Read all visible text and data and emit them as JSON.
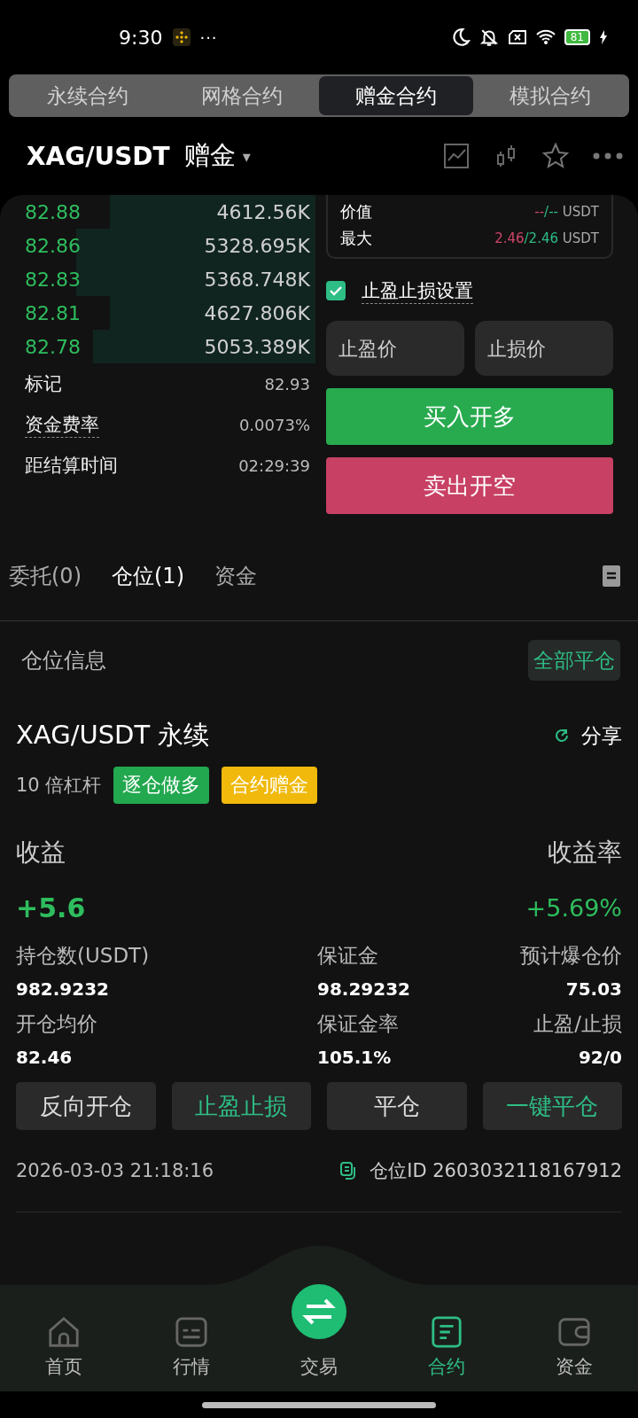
{
  "status_bar": {
    "time": "9:30",
    "more": "···",
    "battery": "81"
  },
  "contract_tabs": [
    {
      "label": "永续合约",
      "selected": false
    },
    {
      "label": "网格合约",
      "selected": false
    },
    {
      "label": "赠金合约",
      "selected": true
    },
    {
      "label": "模拟合约",
      "selected": false
    }
  ],
  "header": {
    "symbol": "XAG/USDT",
    "type": "赠金",
    "caret": "▾"
  },
  "order_book": [
    {
      "price": "82.88",
      "amount": "4612.56K"
    },
    {
      "price": "82.86",
      "amount": "5328.695K"
    },
    {
      "price": "82.83",
      "amount": "5368.748K"
    },
    {
      "price": "82.81",
      "amount": "4627.806K"
    },
    {
      "price": "82.78",
      "amount": "5053.389K"
    }
  ],
  "market_stats": [
    {
      "label": "标记",
      "value": "82.93",
      "dotted": false
    },
    {
      "label": "资金费率",
      "value": "0.0073%",
      "dotted": true
    },
    {
      "label": "距结算时间",
      "value": "02:29:39",
      "dotted": false
    }
  ],
  "order_info": [
    {
      "label": "价值",
      "long": "--",
      "short": "/--",
      "unit": "USDT"
    },
    {
      "label": "最大",
      "long": "2.46",
      "short": "/2.46",
      "unit": "USDT"
    }
  ],
  "tp_sl": {
    "label": "止盈止损设置",
    "checked": true,
    "take_profit_placeholder": "止盈价",
    "stop_loss_placeholder": "止损价"
  },
  "buy_button": "买入开多",
  "sell_button": "卖出开空",
  "bottom_tabs": [
    {
      "label": "委托(0)",
      "selected": false
    },
    {
      "label": "仓位(1)",
      "selected": true
    },
    {
      "label": "资金",
      "selected": false
    }
  ],
  "position_section": {
    "title": "仓位信息",
    "close_all": "全部平仓"
  },
  "position": {
    "symbol": "XAG/USDT 永续",
    "share": "分享",
    "leverage": "10 倍杠杆",
    "tags": [
      {
        "label": "逐仓做多",
        "color": "#22a84f"
      },
      {
        "label": "合约赠金",
        "color": "#f0b90b"
      }
    ],
    "pnl_label": "收益",
    "pnl_rate_label": "收益率",
    "pnl": "+5.6",
    "pnl_rate": "+5.69%",
    "fields": [
      {
        "label": "持仓数(USDT)",
        "value": "982.9232"
      },
      {
        "label": "保证金",
        "value": "98.29232"
      },
      {
        "label": "预计爆仓价",
        "value": "75.03"
      },
      {
        "label": "开仓均价",
        "value": "82.46"
      },
      {
        "label": "保证金率",
        "value": "105.1%"
      },
      {
        "label": "止盈/止损",
        "value": "92/0"
      }
    ],
    "actions": [
      {
        "label": "反向开仓",
        "accent": false
      },
      {
        "label": "止盈止损",
        "accent": true
      },
      {
        "label": "平仓",
        "accent": false
      },
      {
        "label": "一键平仓",
        "accent": true
      }
    ],
    "time": "2026-03-03 21:18:16",
    "position_id": "仓位ID 2603032118167912"
  },
  "nav": [
    {
      "label": "首页",
      "kind": "home",
      "selected": false
    },
    {
      "label": "行情",
      "kind": "market",
      "selected": false
    },
    {
      "label": "交易",
      "kind": "trade",
      "selected": false
    },
    {
      "label": "合约",
      "kind": "contract",
      "selected": true
    },
    {
      "label": "资金",
      "kind": "wallet",
      "selected": false
    }
  ]
}
